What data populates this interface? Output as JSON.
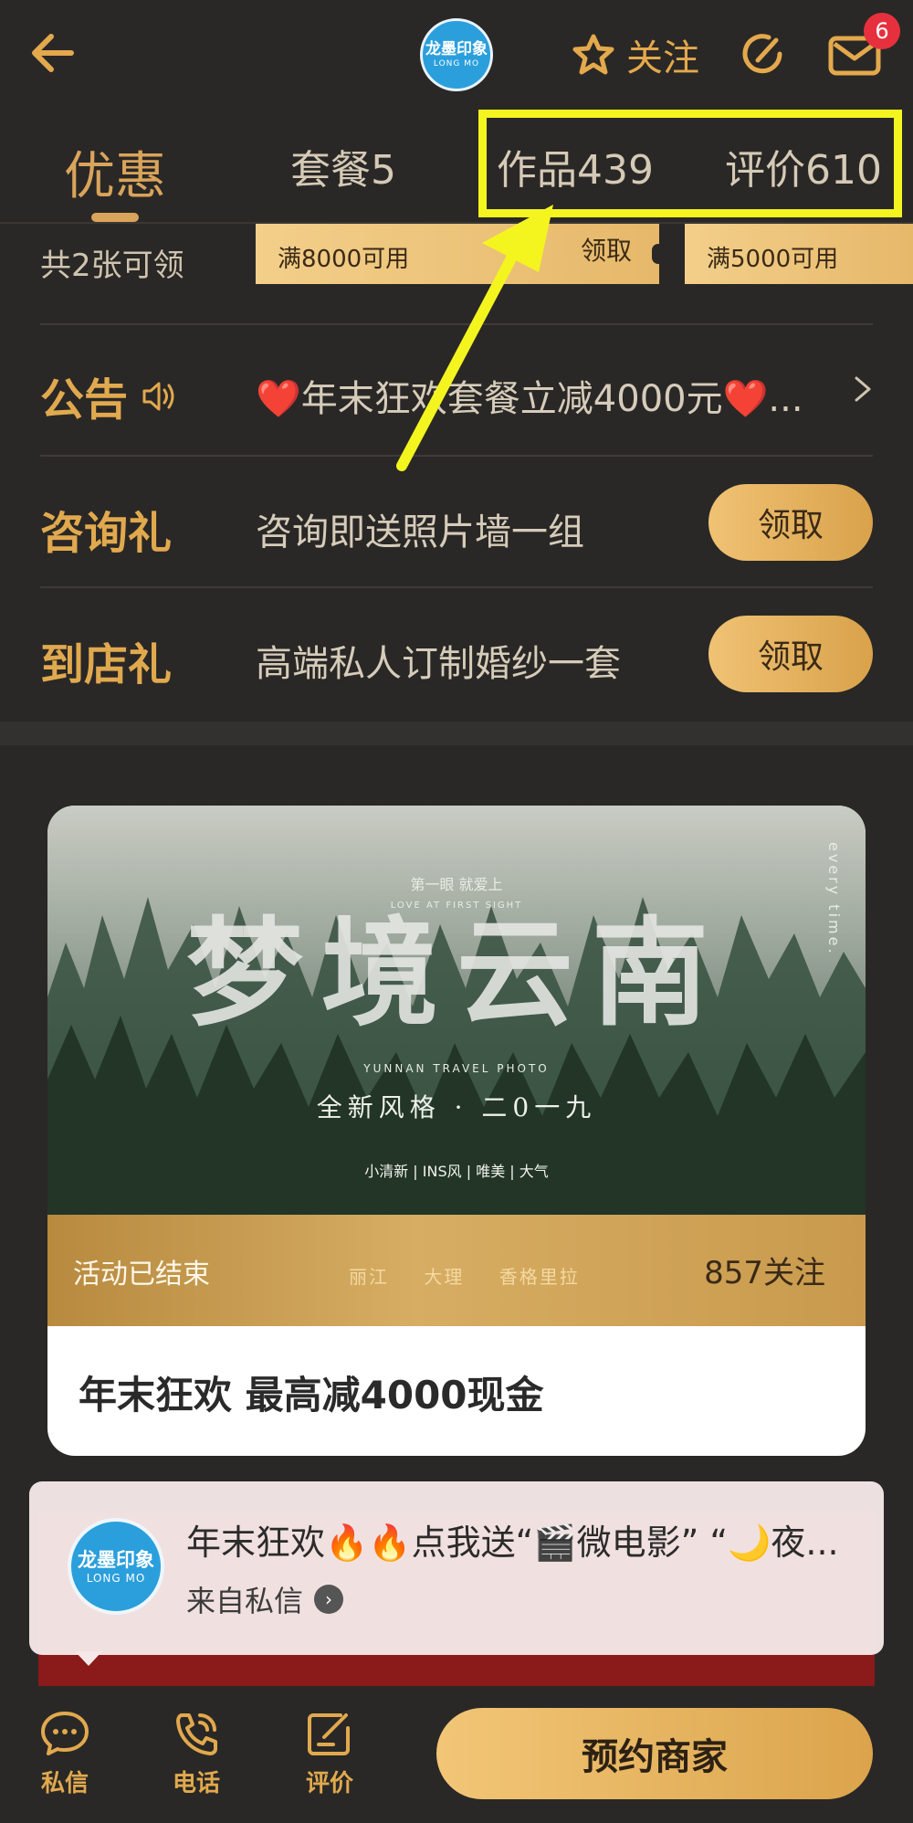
{
  "header": {
    "logo_line1": "龙墨印象",
    "logo_line2": "LONG MO",
    "follow_label": "关注",
    "mail_badge": "6"
  },
  "tabs": [
    {
      "label": "优惠",
      "active": true
    },
    {
      "label": "套餐5",
      "active": false
    },
    {
      "label": "作品439",
      "active": false
    },
    {
      "label": "评价610",
      "active": false
    }
  ],
  "coupons": {
    "count_text": "共2张可领",
    "items": [
      {
        "condition": "满8000可用",
        "action": "领取"
      },
      {
        "condition": "满5000可用",
        "action": ""
      }
    ]
  },
  "notice": {
    "label": "公告",
    "text": "❤️年末狂欢套餐立减4000元❤️..."
  },
  "gifts": [
    {
      "label": "咨询礼",
      "text": "咨询即送照片墙一组",
      "action": "领取"
    },
    {
      "label": "到店礼",
      "text": "高端私人订制婚纱一套",
      "action": "领取"
    }
  ],
  "activity": {
    "poster": {
      "small_top": "第一眼 就爱上",
      "small_top_en": "LOVE AT FIRST SIGHT",
      "main_title": "梦境云南",
      "subtitle_en": "YUNNAN TRAVEL PHOTO",
      "tagline": "全新风格 · 二0一九",
      "tags": "小清新 | INS风 | 唯美 | 大气",
      "side_text": "every time.",
      "places": "丽江 大理 香格里拉"
    },
    "status": "活动已结束",
    "follows": "857关注",
    "title": "年末狂欢 最高减4000现金"
  },
  "message": {
    "avatar_line1": "龙墨印象",
    "avatar_line2": "LONG MO",
    "text": "年末狂欢🔥🔥点我送“🎬微电影” “🌙夜...",
    "from": "来自私信"
  },
  "bottom_bar": {
    "chat_label": "私信",
    "phone_label": "电话",
    "review_label": "评价",
    "book_label": "预约商家"
  },
  "colors": {
    "background": "#2a2826",
    "accent_gold": "#e1a94e",
    "annotation_yellow": "#f4f51f",
    "badge_red": "#e7303e"
  }
}
